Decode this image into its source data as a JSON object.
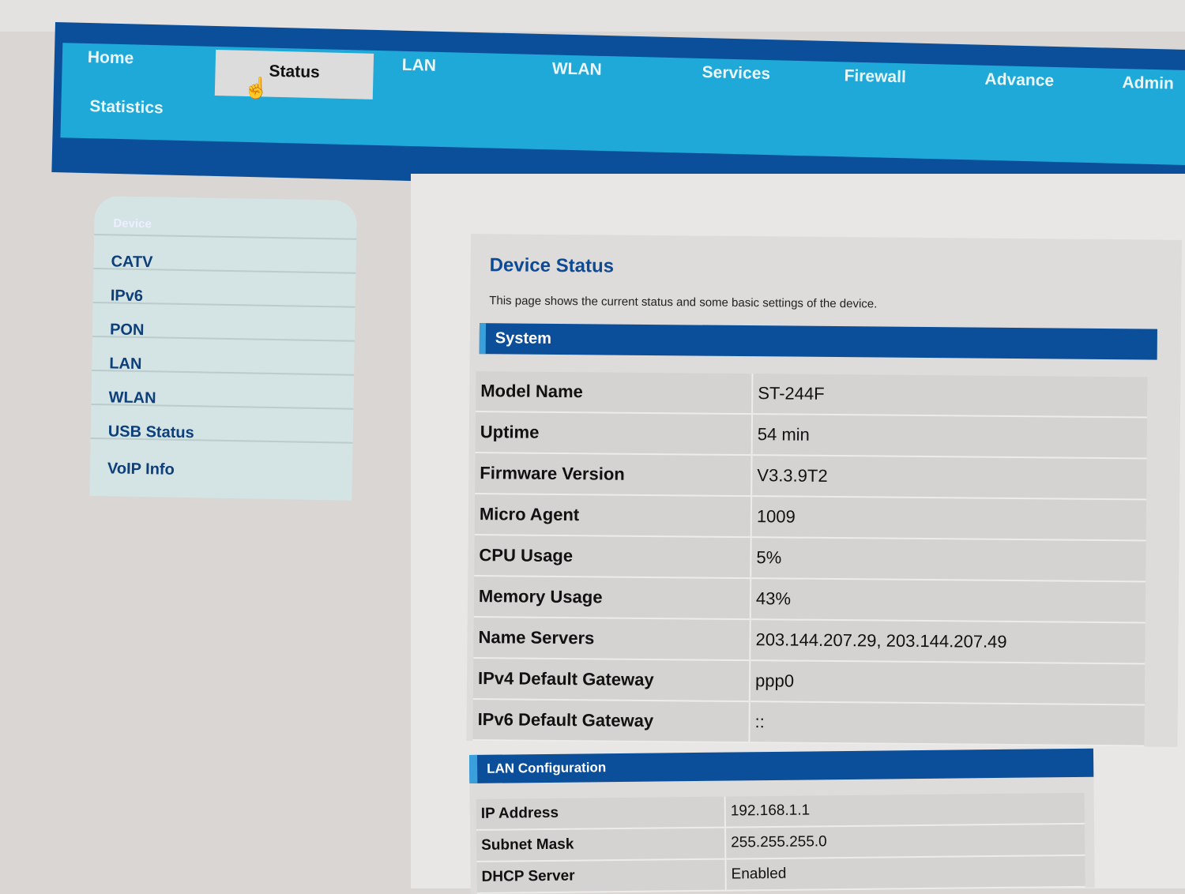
{
  "nav": {
    "items": [
      "Home",
      "Status",
      "LAN",
      "WLAN",
      "Services",
      "Firewall",
      "Advance",
      "Admin",
      "Statistics"
    ],
    "active": "Status"
  },
  "sidebar": {
    "header": "Device",
    "items": [
      "CATV",
      "IPv6",
      "PON",
      "LAN",
      "WLAN",
      "USB Status",
      "VoIP Info"
    ]
  },
  "page": {
    "title": "Device Status",
    "description": "This page shows the current status and some basic settings of the device."
  },
  "system": {
    "title": "System",
    "rows": [
      {
        "label": "Model Name",
        "value": "ST-244F"
      },
      {
        "label": "Uptime",
        "value": "54 min"
      },
      {
        "label": "Firmware Version",
        "value": "V3.3.9T2"
      },
      {
        "label": "Micro Agent",
        "value": "1009"
      },
      {
        "label": "CPU Usage",
        "value": "5%"
      },
      {
        "label": "Memory Usage",
        "value": "43%"
      },
      {
        "label": "Name Servers",
        "value": "203.144.207.29, 203.144.207.49"
      },
      {
        "label": "IPv4 Default Gateway",
        "value": "ppp0"
      },
      {
        "label": "IPv6 Default Gateway",
        "value": "::"
      }
    ]
  },
  "lan": {
    "title": "LAN Configuration",
    "rows": [
      {
        "label": "IP Address",
        "value": "192.168.1.1"
      },
      {
        "label": "Subnet Mask",
        "value": "255.255.255.0"
      },
      {
        "label": "DHCP Server",
        "value": "Enabled"
      }
    ]
  }
}
